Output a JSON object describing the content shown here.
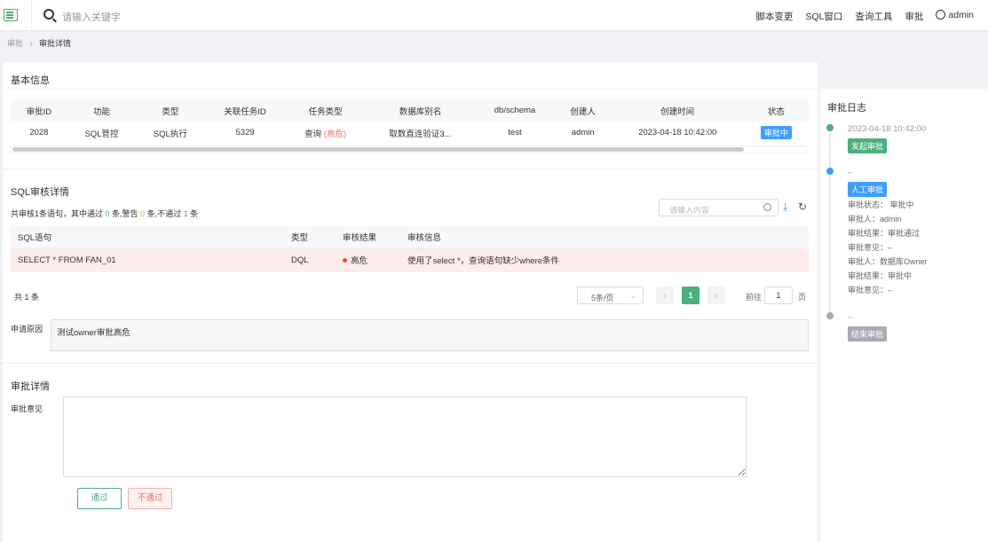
{
  "topbar": {
    "search_placeholder": "请输入关键字",
    "nav": [
      "脚本变更",
      "SQL窗口",
      "查询工具",
      "审批"
    ],
    "user": "admin"
  },
  "breadcrumb": {
    "parent": "审批",
    "current": "审批详情"
  },
  "basic_info": {
    "title": "基本信息",
    "columns": [
      "审批ID",
      "功能",
      "类型",
      "关联任务ID",
      "任务类型",
      "数据库别名",
      "db/schema",
      "创建人",
      "创建时间",
      "状态"
    ],
    "row": {
      "id": "2028",
      "func": "SQL管控",
      "type": "SQL执行",
      "task_id": "5329",
      "task_type": "查询",
      "task_level": "(高危)",
      "db_alias": "取数直连验证3...",
      "schema": "test",
      "creator": "admin",
      "created": "2023-04-18 10:42:00",
      "status": "审批中"
    }
  },
  "sql_review": {
    "title": "SQL审核详情",
    "summary_prefix": "共审核1条语句，其中通过 ",
    "pass_count": "0",
    "summary_mid": " 条,警告 ",
    "warn_count": "0",
    "summary_mid2": " 条,不通过 ",
    "fail_count": "1",
    "summary_suffix": " 条",
    "search_placeholder": "请输入内容",
    "columns": [
      "SQL语句",
      "类型",
      "审核结果",
      "审核信息"
    ],
    "row": {
      "sql": "SELECT * FROM FAN_01",
      "type": "DQL",
      "result": "高危",
      "info": "使用了select *，查询语句缺少where条件"
    },
    "total": "共 1 条",
    "page_size": "5条/页",
    "current_page": "1",
    "goto_label": "前往",
    "goto_value": "1",
    "page_unit": "页"
  },
  "reason": {
    "label": "申请原因",
    "value": "测试owner审批高危"
  },
  "approval": {
    "title": "审批详情",
    "opinion_label": "审批意见",
    "pass_label": "通过",
    "reject_label": "不通过"
  },
  "log": {
    "title": "审批日志",
    "entries": [
      {
        "time": "2023-04-18 10:42:00",
        "tag": "发起审批",
        "tag_color": "#4caf7d"
      },
      {
        "time": "–",
        "tag": "人工审批",
        "tag_color": "#409eff",
        "lines": [
          "审批状态： 审批中",
          "审批人：admin",
          "审批结果：审批通过",
          "审批意见：–",
          "审批人：数据库Owner",
          "审批结果：审批中",
          "审批意见：–"
        ]
      },
      {
        "time": "–",
        "tag": "结束审批",
        "tag_color": "#a8abb2"
      }
    ]
  }
}
